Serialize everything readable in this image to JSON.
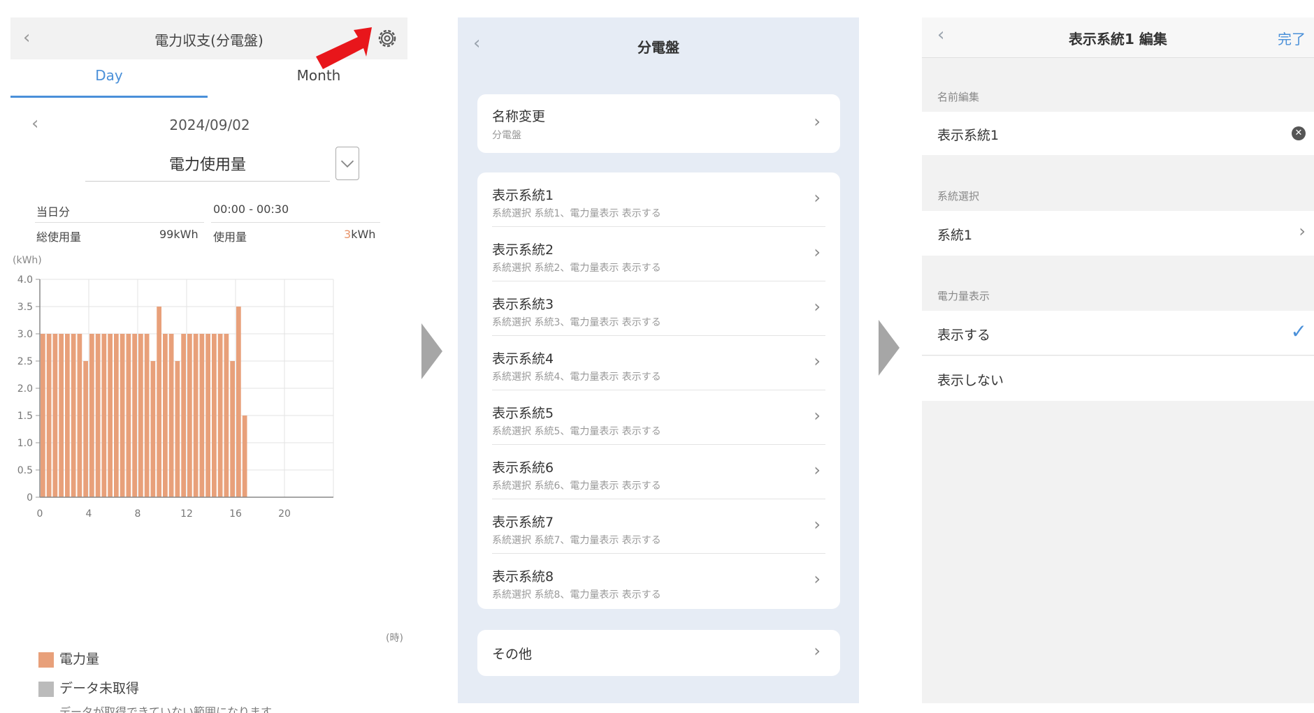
{
  "panel1": {
    "title": "電力収支(分電盤)",
    "tabs": [
      "Day",
      "Month"
    ],
    "date": "2024/09/02",
    "metric": "電力使用量",
    "stats": {
      "period_label": "当日分",
      "time_range": "00:00 - 00:30",
      "total_label": "総使用量",
      "total_value": "99",
      "total_unit": "kWh",
      "usage_label": "使用量",
      "usage_value": "3",
      "usage_unit": "kWh"
    },
    "chart_unit": "(kWh)",
    "x_unit": "(時)",
    "legend": [
      {
        "label": "電力量",
        "color": "#e8a07a"
      },
      {
        "label": "データ未取得",
        "color": "#bbbbbb"
      }
    ],
    "legend_note": "データが取得できていない範囲になります。"
  },
  "chart_data": {
    "type": "bar",
    "ylabel": "(kWh)",
    "xlabel": "(時)",
    "ylim": [
      0,
      4.0
    ],
    "xlim": [
      0,
      24
    ],
    "y_ticks": [
      "4.0",
      "3.5",
      "3.0",
      "2.5",
      "2.0",
      "1.5",
      "1.0",
      "0.5",
      "0"
    ],
    "x_ticks": [
      "0",
      "4",
      "8",
      "12",
      "16",
      "20"
    ],
    "grid": true,
    "bar_color": "#e8a07a",
    "x": [
      0,
      0.5,
      1,
      1.5,
      2,
      2.5,
      3,
      3.5,
      4,
      4.5,
      5,
      5.5,
      6,
      6.5,
      7,
      7.5,
      8,
      8.5,
      9,
      9.5,
      10,
      10.5,
      11,
      11.5,
      12,
      12.5,
      13,
      13.5,
      14,
      14.5,
      15,
      15.5,
      16,
      16.5
    ],
    "values": [
      3.0,
      3.0,
      3.0,
      3.0,
      3.0,
      3.0,
      3.0,
      2.5,
      3.0,
      3.0,
      3.0,
      3.0,
      3.0,
      3.0,
      3.0,
      3.0,
      3.0,
      3.0,
      2.5,
      3.5,
      3.0,
      3.0,
      2.5,
      3.0,
      3.0,
      3.0,
      3.0,
      3.0,
      3.0,
      3.0,
      3.0,
      2.5,
      3.5,
      1.5
    ]
  },
  "panel2": {
    "title": "分電盤",
    "rename": {
      "label": "名称変更",
      "sub": "分電盤"
    },
    "systems": [
      {
        "label": "表示系統1",
        "sub": "系統選択 系統1、電力量表示 表示する"
      },
      {
        "label": "表示系統2",
        "sub": "系統選択 系統2、電力量表示 表示する"
      },
      {
        "label": "表示系統3",
        "sub": "系統選択 系統3、電力量表示 表示する"
      },
      {
        "label": "表示系統4",
        "sub": "系統選択 系統4、電力量表示 表示する"
      },
      {
        "label": "表示系統5",
        "sub": "系統選択 系統5、電力量表示 表示する"
      },
      {
        "label": "表示系統6",
        "sub": "系統選択 系統6、電力量表示 表示する"
      },
      {
        "label": "表示系統7",
        "sub": "系統選択 系統7、電力量表示 表示する"
      },
      {
        "label": "表示系統8",
        "sub": "系統選択 系統8、電力量表示 表示する"
      }
    ],
    "other": "その他"
  },
  "panel3": {
    "title": "表示系統1 編集",
    "done": "完了",
    "name_section": "名前編集",
    "name_value": "表示系統1",
    "system_section": "系統選択",
    "system_value": "系統1",
    "display_section": "電力量表示",
    "show_option": "表示する",
    "hide_option": "表示しない"
  }
}
